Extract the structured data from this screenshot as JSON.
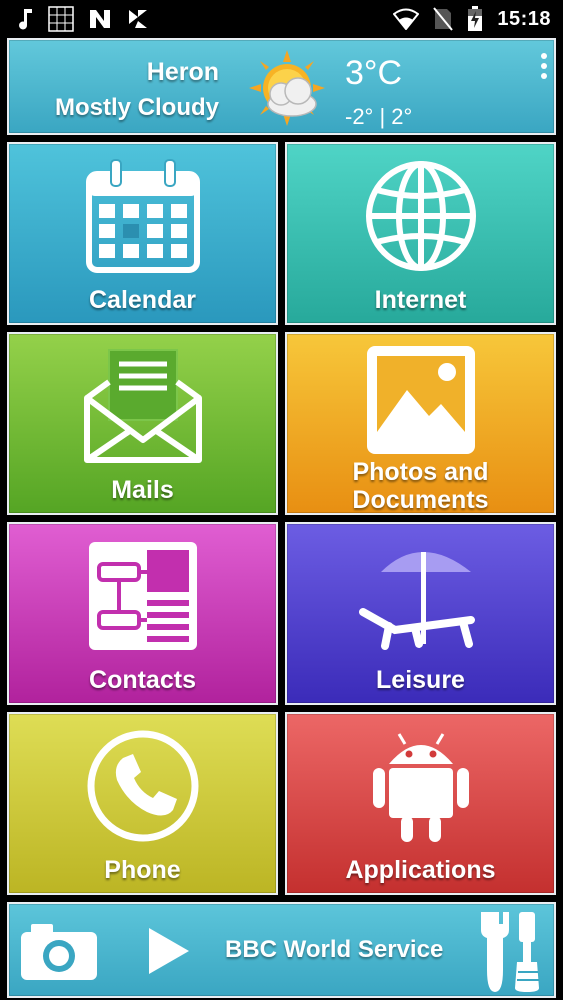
{
  "status_bar": {
    "time": "15:18",
    "left_icons": [
      "music-note-icon",
      "sudoku-icon",
      "n-app-icon",
      "check-app-icon"
    ],
    "right_icons": [
      "wifi-icon",
      "no-sim-icon",
      "battery-icon"
    ]
  },
  "weather": {
    "city": "Heron",
    "condition": "Mostly Cloudy",
    "temperature": "3°C",
    "range": "-2° | 2°"
  },
  "tiles": {
    "calendar": "Calendar",
    "internet": "Internet",
    "mails": "Mails",
    "photos_line1": "Photos and",
    "photos_line2": "Documents",
    "contacts": "Contacts",
    "leisure": "Leisure",
    "phone": "Phone",
    "applications": "Applications"
  },
  "radio": {
    "station": "BBC World Service"
  }
}
